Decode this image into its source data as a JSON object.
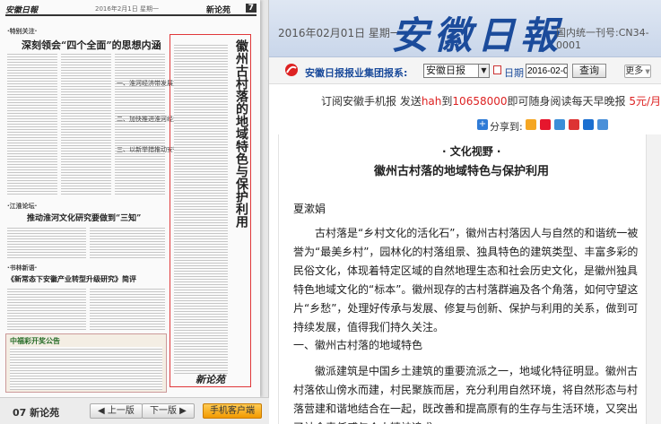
{
  "header": {
    "date_text": "2016年02月01日 星期一",
    "logo_text": "安徽日報",
    "issn_text": "国内统一刊号:CN34-0001"
  },
  "paper": {
    "masthead_left": "安徽日報",
    "masthead_page_label": "新论苑",
    "masthead_page_no": "7",
    "headline_1": "深刻领会“四个全面”的思想内涵",
    "tag_1": "·特别关注·",
    "headline_2": "推动淮河文化研究要做到“三知”",
    "tag_2": "·江淮论坛·",
    "headline_3": "《新常态下安徽产业转型升级研究》简评",
    "tag_3": "·书林新语·",
    "side_text_1": "一、淮河经济带发展对安徽的意义",
    "side_text_2": "二、加快推进淮河经济带建设",
    "side_text_3": "三、以新举措推动安徽全面振兴",
    "vertical_title": "徽州古村落的地域特色与保护利用",
    "ad_title": "中福彩开奖公告",
    "section_logo": "新论苑"
  },
  "pager": {
    "page_name": "07 新论苑",
    "prev_label": "上一版",
    "next_label": "下一版",
    "client_label": "手机客户端"
  },
  "toolbar": {
    "group_label": "安徽日报报业集团报系:",
    "paper_select_value": "安徽日报",
    "date_label": "日期",
    "date_value": "2016-02-01",
    "query_label": "查询",
    "more_label": "更多"
  },
  "promo": {
    "part1": "订阅安徽手机报  发送",
    "keyword": "hah",
    "part2": "到",
    "number": "10658000",
    "part3": "即可随身阅读每天早晚报  ",
    "price": "5元/月"
  },
  "share": {
    "label": "分享到:"
  },
  "article": {
    "kicker": "· 文化视野 ·",
    "title": "徽州古村落的地域特色与保护利用",
    "author": "夏漱娟",
    "para1": "古村落是“乡村文化的活化石”，徽州古村落因人与自然的和谐统一被誉为“最美乡村”，园林化的村落组景、独具特色的建筑类型、丰富多彩的民俗文化，体现着特定区域的自然地理生态和社会历史文化，是徽州独具特色地域文化的“标本”。徽州现存的古村落群遍及各个角落，如何守望这片“乡愁”，处理好传承与发展、修复与创新、保护与利用的关系，做到可持续发展，值得我们持久关注。",
    "subhead": "一、徽州古村落的地域特色",
    "para2": "徽派建筑是中国乡土建筑的重要流派之一，地域化特征明显。徽州古村落依山傍水而建，村民聚族而居，充分利用自然环境，将自然形态与村落营建和谐地结合在一起，既改善和提高原有的生存与生活环境，又突出了社会责任感与个人精神追求。"
  },
  "colors": {
    "brand_blue": "#1b4b9b",
    "highlight_red": "#e0383a",
    "button_orange": "#f29a00"
  }
}
